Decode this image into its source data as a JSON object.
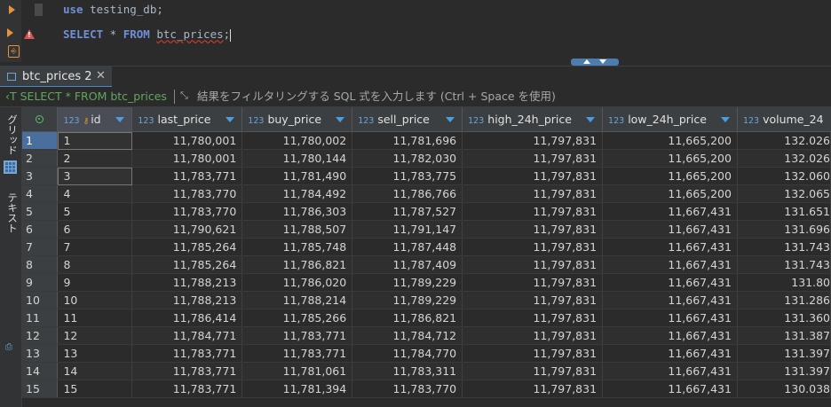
{
  "editor": {
    "line1": {
      "keyword": "use",
      "text": " testing_db;"
    },
    "line2": {
      "keyword1": "SELECT",
      "star": " * ",
      "keyword2": "FROM",
      "table": "btc_prices",
      "tail": ";"
    }
  },
  "results_tab": {
    "label": "btc_prices 2",
    "close": "✕"
  },
  "filter": {
    "sql": "SELECT * FROM btc_prices",
    "placeholder": "結果をフィルタリングする SQL 式を入力します (Ctrl + Space を使用)"
  },
  "side_tabs": {
    "grid": "グリッド",
    "text": "テキスト"
  },
  "columns": [
    {
      "type": "123",
      "name": "id",
      "key": true
    },
    {
      "type": "123",
      "name": "last_price"
    },
    {
      "type": "123",
      "name": "buy_price"
    },
    {
      "type": "123",
      "name": "sell_price"
    },
    {
      "type": "123",
      "name": "high_24h_price"
    },
    {
      "type": "123",
      "name": "low_24h_price"
    },
    {
      "type": "123",
      "name": "volume_24"
    }
  ],
  "rows": [
    [
      "1",
      "1",
      "11,780,001",
      "11,780,002",
      "11,781,696",
      "11,797,831",
      "11,665,200",
      "132.026"
    ],
    [
      "2",
      "2",
      "11,780,001",
      "11,780,144",
      "11,782,030",
      "11,797,831",
      "11,665,200",
      "132.026"
    ],
    [
      "3",
      "3",
      "11,783,771",
      "11,781,490",
      "11,783,775",
      "11,797,831",
      "11,665,200",
      "132.060"
    ],
    [
      "4",
      "4",
      "11,783,770",
      "11,784,492",
      "11,786,766",
      "11,797,831",
      "11,665,200",
      "132.065"
    ],
    [
      "5",
      "5",
      "11,783,770",
      "11,786,303",
      "11,787,527",
      "11,797,831",
      "11,667,431",
      "131.651"
    ],
    [
      "6",
      "6",
      "11,790,621",
      "11,788,507",
      "11,791,147",
      "11,797,831",
      "11,667,431",
      "131.696"
    ],
    [
      "7",
      "7",
      "11,785,264",
      "11,785,748",
      "11,787,448",
      "11,797,831",
      "11,667,431",
      "131.743"
    ],
    [
      "8",
      "8",
      "11,785,264",
      "11,786,821",
      "11,787,409",
      "11,797,831",
      "11,667,431",
      "131.743"
    ],
    [
      "9",
      "9",
      "11,788,213",
      "11,786,020",
      "11,789,229",
      "11,797,831",
      "11,667,431",
      "131.80"
    ],
    [
      "10",
      "10",
      "11,788,213",
      "11,788,214",
      "11,789,229",
      "11,797,831",
      "11,667,431",
      "131.286"
    ],
    [
      "11",
      "11",
      "11,786,414",
      "11,785,266",
      "11,786,821",
      "11,797,831",
      "11,667,431",
      "131.360"
    ],
    [
      "12",
      "12",
      "11,784,771",
      "11,783,771",
      "11,784,712",
      "11,797,831",
      "11,667,431",
      "131.387"
    ],
    [
      "13",
      "13",
      "11,783,771",
      "11,783,771",
      "11,784,770",
      "11,797,831",
      "11,667,431",
      "131.397"
    ],
    [
      "14",
      "14",
      "11,783,771",
      "11,781,061",
      "11,783,311",
      "11,797,831",
      "11,667,431",
      "131.397"
    ],
    [
      "15",
      "15",
      "11,783,771",
      "11,781,394",
      "11,783,770",
      "11,797,831",
      "11,667,431",
      "130.038"
    ]
  ],
  "colors": {
    "accent": "#4a88c7",
    "keyword": "#6f8fd8",
    "filter_sql": "#5fa85f",
    "type_label": "#6aa3d9"
  }
}
